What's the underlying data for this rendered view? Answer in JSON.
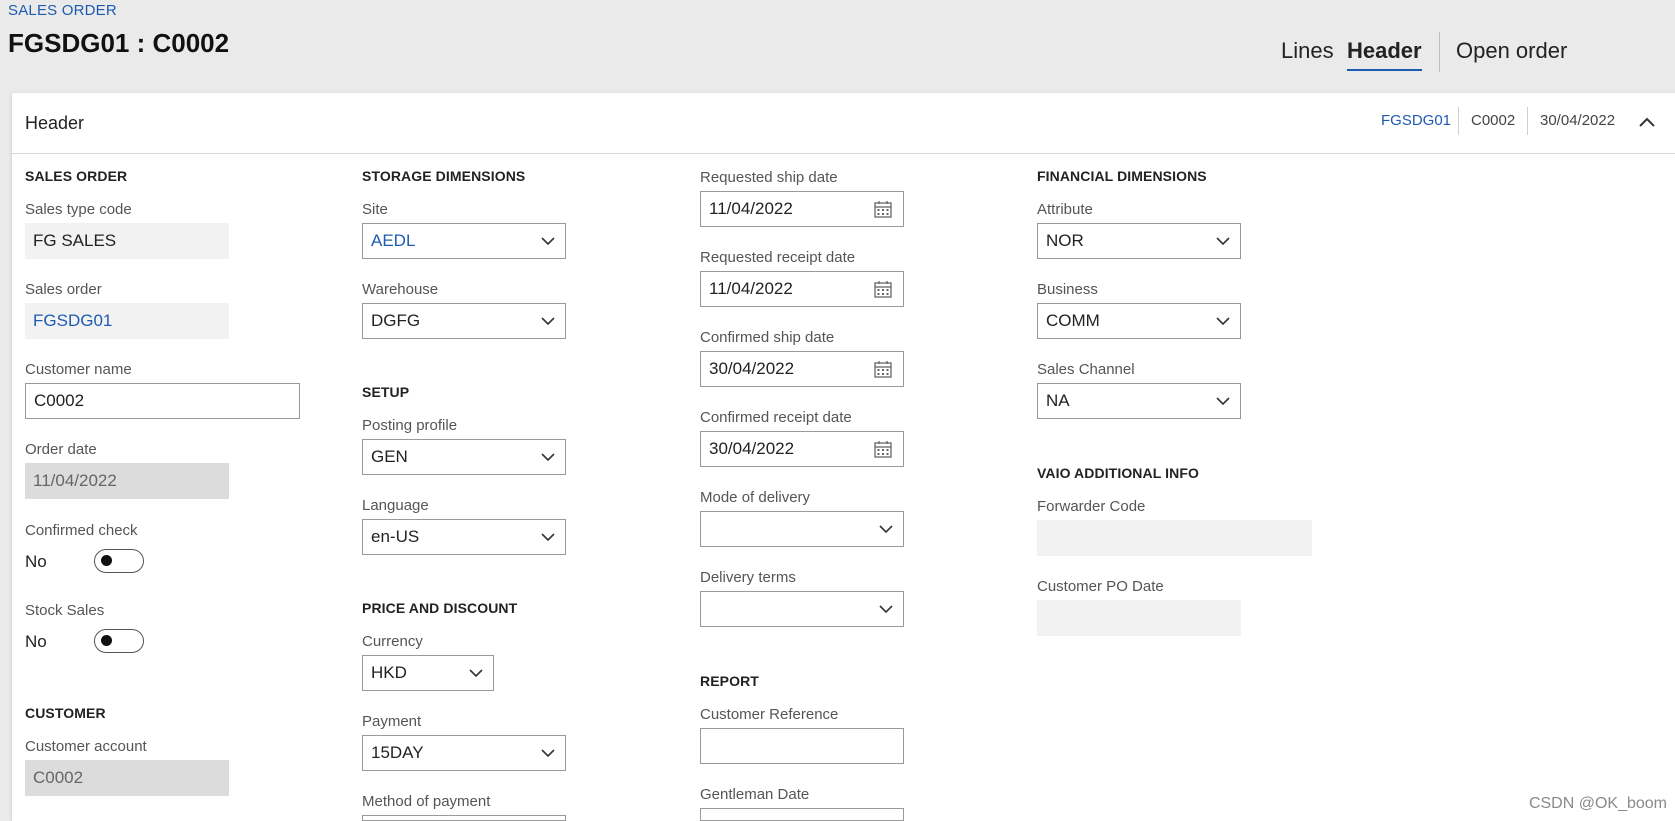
{
  "breadcrumb": "SALES ORDER",
  "page_title": "FGSDG01 : C0002",
  "tabs": {
    "lines": "Lines",
    "header": "Header",
    "open_order": "Open order"
  },
  "panel": {
    "title": "Header",
    "summary": {
      "order": "FGSDG01",
      "customer": "C0002",
      "date": "30/04/2022"
    }
  },
  "sales_order": {
    "heading": "SALES ORDER",
    "sales_type_code": {
      "label": "Sales type code",
      "value": "FG SALES"
    },
    "sales_order": {
      "label": "Sales order",
      "value": "FGSDG01"
    },
    "customer_name": {
      "label": "Customer name",
      "value": "C0002"
    },
    "order_date": {
      "label": "Order date",
      "value": "11/04/2022"
    },
    "confirmed_check": {
      "label": "Confirmed check",
      "value": "No"
    },
    "stock_sales": {
      "label": "Stock Sales",
      "value": "No"
    }
  },
  "customer": {
    "heading": "CUSTOMER",
    "customer_account": {
      "label": "Customer account",
      "value": "C0002"
    }
  },
  "storage_dimensions": {
    "heading": "STORAGE DIMENSIONS",
    "site": {
      "label": "Site",
      "value": "AEDL"
    },
    "warehouse": {
      "label": "Warehouse",
      "value": "DGFG"
    }
  },
  "setup": {
    "heading": "SETUP",
    "posting_profile": {
      "label": "Posting profile",
      "value": "GEN"
    },
    "language": {
      "label": "Language",
      "value": "en-US"
    }
  },
  "price_discount": {
    "heading": "PRICE AND DISCOUNT",
    "currency": {
      "label": "Currency",
      "value": "HKD"
    },
    "payment": {
      "label": "Payment",
      "value": "15DAY"
    },
    "method_of_payment": {
      "label": "Method of payment",
      "value": ""
    }
  },
  "dates": {
    "requested_ship_date": {
      "label": "Requested ship date",
      "value": "11/04/2022"
    },
    "requested_receipt_date": {
      "label": "Requested receipt date",
      "value": "11/04/2022"
    },
    "confirmed_ship_date": {
      "label": "Confirmed ship date",
      "value": "30/04/2022"
    },
    "confirmed_receipt_date": {
      "label": "Confirmed receipt date",
      "value": "30/04/2022"
    },
    "mode_of_delivery": {
      "label": "Mode of delivery",
      "value": ""
    },
    "delivery_terms": {
      "label": "Delivery terms",
      "value": ""
    }
  },
  "report": {
    "heading": "REPORT",
    "customer_reference": {
      "label": "Customer Reference",
      "value": ""
    },
    "gentleman_date": {
      "label": "Gentleman Date",
      "value": ""
    }
  },
  "financial_dimensions": {
    "heading": "FINANCIAL DIMENSIONS",
    "attribute": {
      "label": "Attribute",
      "value": "NOR"
    },
    "business": {
      "label": "Business",
      "value": "COMM"
    },
    "sales_channel": {
      "label": "Sales Channel",
      "value": "NA"
    }
  },
  "vaio_info": {
    "heading": "VAIO ADDITIONAL INFO",
    "forwarder_code": {
      "label": "Forwarder Code",
      "value": ""
    },
    "customer_po_date": {
      "label": "Customer PO Date",
      "value": ""
    }
  },
  "watermark": "CSDN @OK_boom",
  "colors": {
    "link": "#1e5bb0",
    "background": "#eaeaea",
    "panel": "#ffffff"
  },
  "icons": [
    "chevron-up-icon",
    "chevron-down-icon",
    "calendar-icon"
  ]
}
